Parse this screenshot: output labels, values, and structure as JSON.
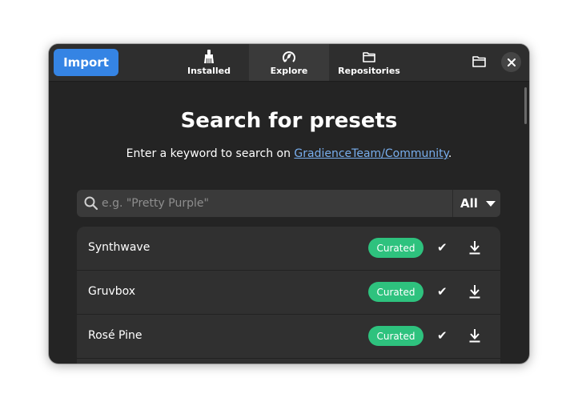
{
  "header": {
    "import_label": "Import",
    "tabs": [
      {
        "label": "Installed",
        "icon": "brush-icon"
      },
      {
        "label": "Explore",
        "icon": "explore-icon"
      },
      {
        "label": "Repositories",
        "icon": "folder-icon"
      }
    ],
    "active_tab": "Explore"
  },
  "content": {
    "title": "Search for presets",
    "subtitle_prefix": "Enter a keyword to search on ",
    "subtitle_link": "GradienceTeam/Community",
    "subtitle_suffix": ".",
    "search": {
      "placeholder": "e.g. \"Pretty Purple\"",
      "filter_value": "All"
    },
    "presets": [
      {
        "name": "Synthwave",
        "badge": "Curated",
        "check": "✔"
      },
      {
        "name": "Gruvbox",
        "badge": "Curated",
        "check": "✔"
      },
      {
        "name": "Rosé Pine",
        "badge": "Curated",
        "check": "✔"
      }
    ]
  },
  "colors": {
    "accent": "#3584e4",
    "curated_badge": "#2ec27e",
    "link": "#78aeed",
    "window_bg": "#242424"
  }
}
